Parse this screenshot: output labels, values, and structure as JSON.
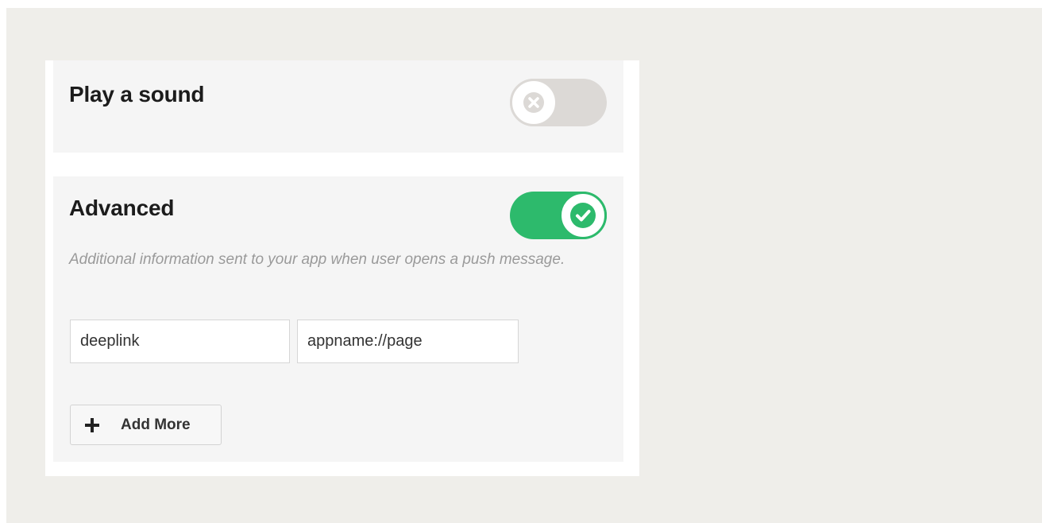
{
  "sound": {
    "title": "Play a sound",
    "toggle_state": "off",
    "toggle_icon": "x-icon"
  },
  "advanced": {
    "title": "Advanced",
    "toggle_state": "on",
    "toggle_icon": "check-icon",
    "description": "Additional information sent to your app when user opens a push message.",
    "pairs": [
      {
        "key": "deeplink",
        "value": "appname://page"
      }
    ],
    "add_more_label": "Add More",
    "add_more_icon": "plus-icon"
  },
  "colors": {
    "toggle_on": "#2dba6c",
    "toggle_off": "#dcd9d6",
    "background": "#efeeea",
    "section_bg": "#f5f5f5"
  }
}
